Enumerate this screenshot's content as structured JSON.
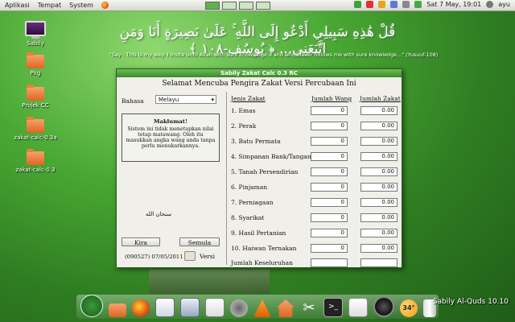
{
  "top_panel": {
    "menus": [
      "Aplikasi",
      "Tempat",
      "System"
    ],
    "datetime": "Sat 7 May, 19:01",
    "user": "ayu"
  },
  "desktop": {
    "arabic_verse": "قُلْ هَٰذِهِ سَبِيلِي أَدْعُو إِلَى اللَّهِ ۚ عَلَىٰ بَصِيرَةٍ أَنَا وَمَنِ اتَّبَعَنِي... ﴿ يُوسُف-١٠٨ ﴾",
    "quote": "\"Say : This is my way: I invite unto Allah with sure knowledge, I and whosoever follows me with sure knowledge...\" (Yusuuf-108)",
    "icons": [
      {
        "label": "Sabily",
        "icon": "monitor-icon"
      },
      {
        "label": "Pkg",
        "icon": "folder-icon"
      },
      {
        "label": "Projek CC",
        "icon": "folder-icon"
      },
      {
        "label": "zakat-calc-0.3a",
        "icon": "folder-icon"
      },
      {
        "label": "zakat-calc-0.3",
        "icon": "folder-icon"
      }
    ]
  },
  "window": {
    "title": "Sabily Zakat Calc 0.3 RC",
    "heading": "Selamat Mencuba Pengira Zakat Versi Percubaan Ini",
    "language_label": "Bahasa",
    "language_value": "Melayu",
    "info_title": "Maklumat!",
    "info_text": "Sistem ini tidak menetapkan nilai tetap matawang. Oleh itu masukkan angka wang anda tanpa perlu menukarkannya.",
    "basmalah": "سبحان الله",
    "btn_calc": "Kira",
    "btn_reset": "Semula",
    "version": "(090527) 07/05/2011",
    "btn_version": "Versi",
    "col_type": "Jenis Zakat",
    "col_money": "Jumlah Wang",
    "col_zakat": "Jumlah Zakat",
    "rows": [
      {
        "label": "1. Emas",
        "money": "0",
        "zakat": "0.00"
      },
      {
        "label": "2. Perak",
        "money": "0",
        "zakat": "0.00"
      },
      {
        "label": "3. Batu Permata",
        "money": "0",
        "zakat": "0.00"
      },
      {
        "label": "4. Simpanan Bank/Tangan",
        "money": "0",
        "zakat": "0.00"
      },
      {
        "label": "5. Tanah Persendirian",
        "money": "0",
        "zakat": "0.00"
      },
      {
        "label": "6. Pinjaman",
        "money": "0",
        "zakat": "0.00"
      },
      {
        "label": "7. Perniagaan",
        "money": "0",
        "zakat": "0.00"
      },
      {
        "label": "8. Syarikat",
        "money": "0",
        "zakat": "0.00"
      },
      {
        "label": "9. Hasil Pertanian",
        "money": "0",
        "zakat": "0.00"
      },
      {
        "label": "10. Haiwan Ternakan",
        "money": "0",
        "zakat": "0.00"
      }
    ],
    "total_label": "Jumlah Keseluruhan",
    "total_money": "",
    "total_zakat": ""
  },
  "dock": {
    "temperature": "34°",
    "brand": "Sabily Al-Quds 10.10",
    "icons": [
      "sabily-logo-icon",
      "folder-icon",
      "firefox-icon",
      "text-editor-icon",
      "settings-icon",
      "calendar-icon",
      "webcam-icon",
      "vlc-cone-icon",
      "home-icon",
      "scissors-icon",
      "terminal-icon",
      "notes-icon",
      "film-reel-icon",
      "weather-icon",
      "trash-icon"
    ]
  },
  "colors": {
    "title_green": "#3b8b2a",
    "desktop_green": "#49a833",
    "accent_orange": "#e06424"
  }
}
